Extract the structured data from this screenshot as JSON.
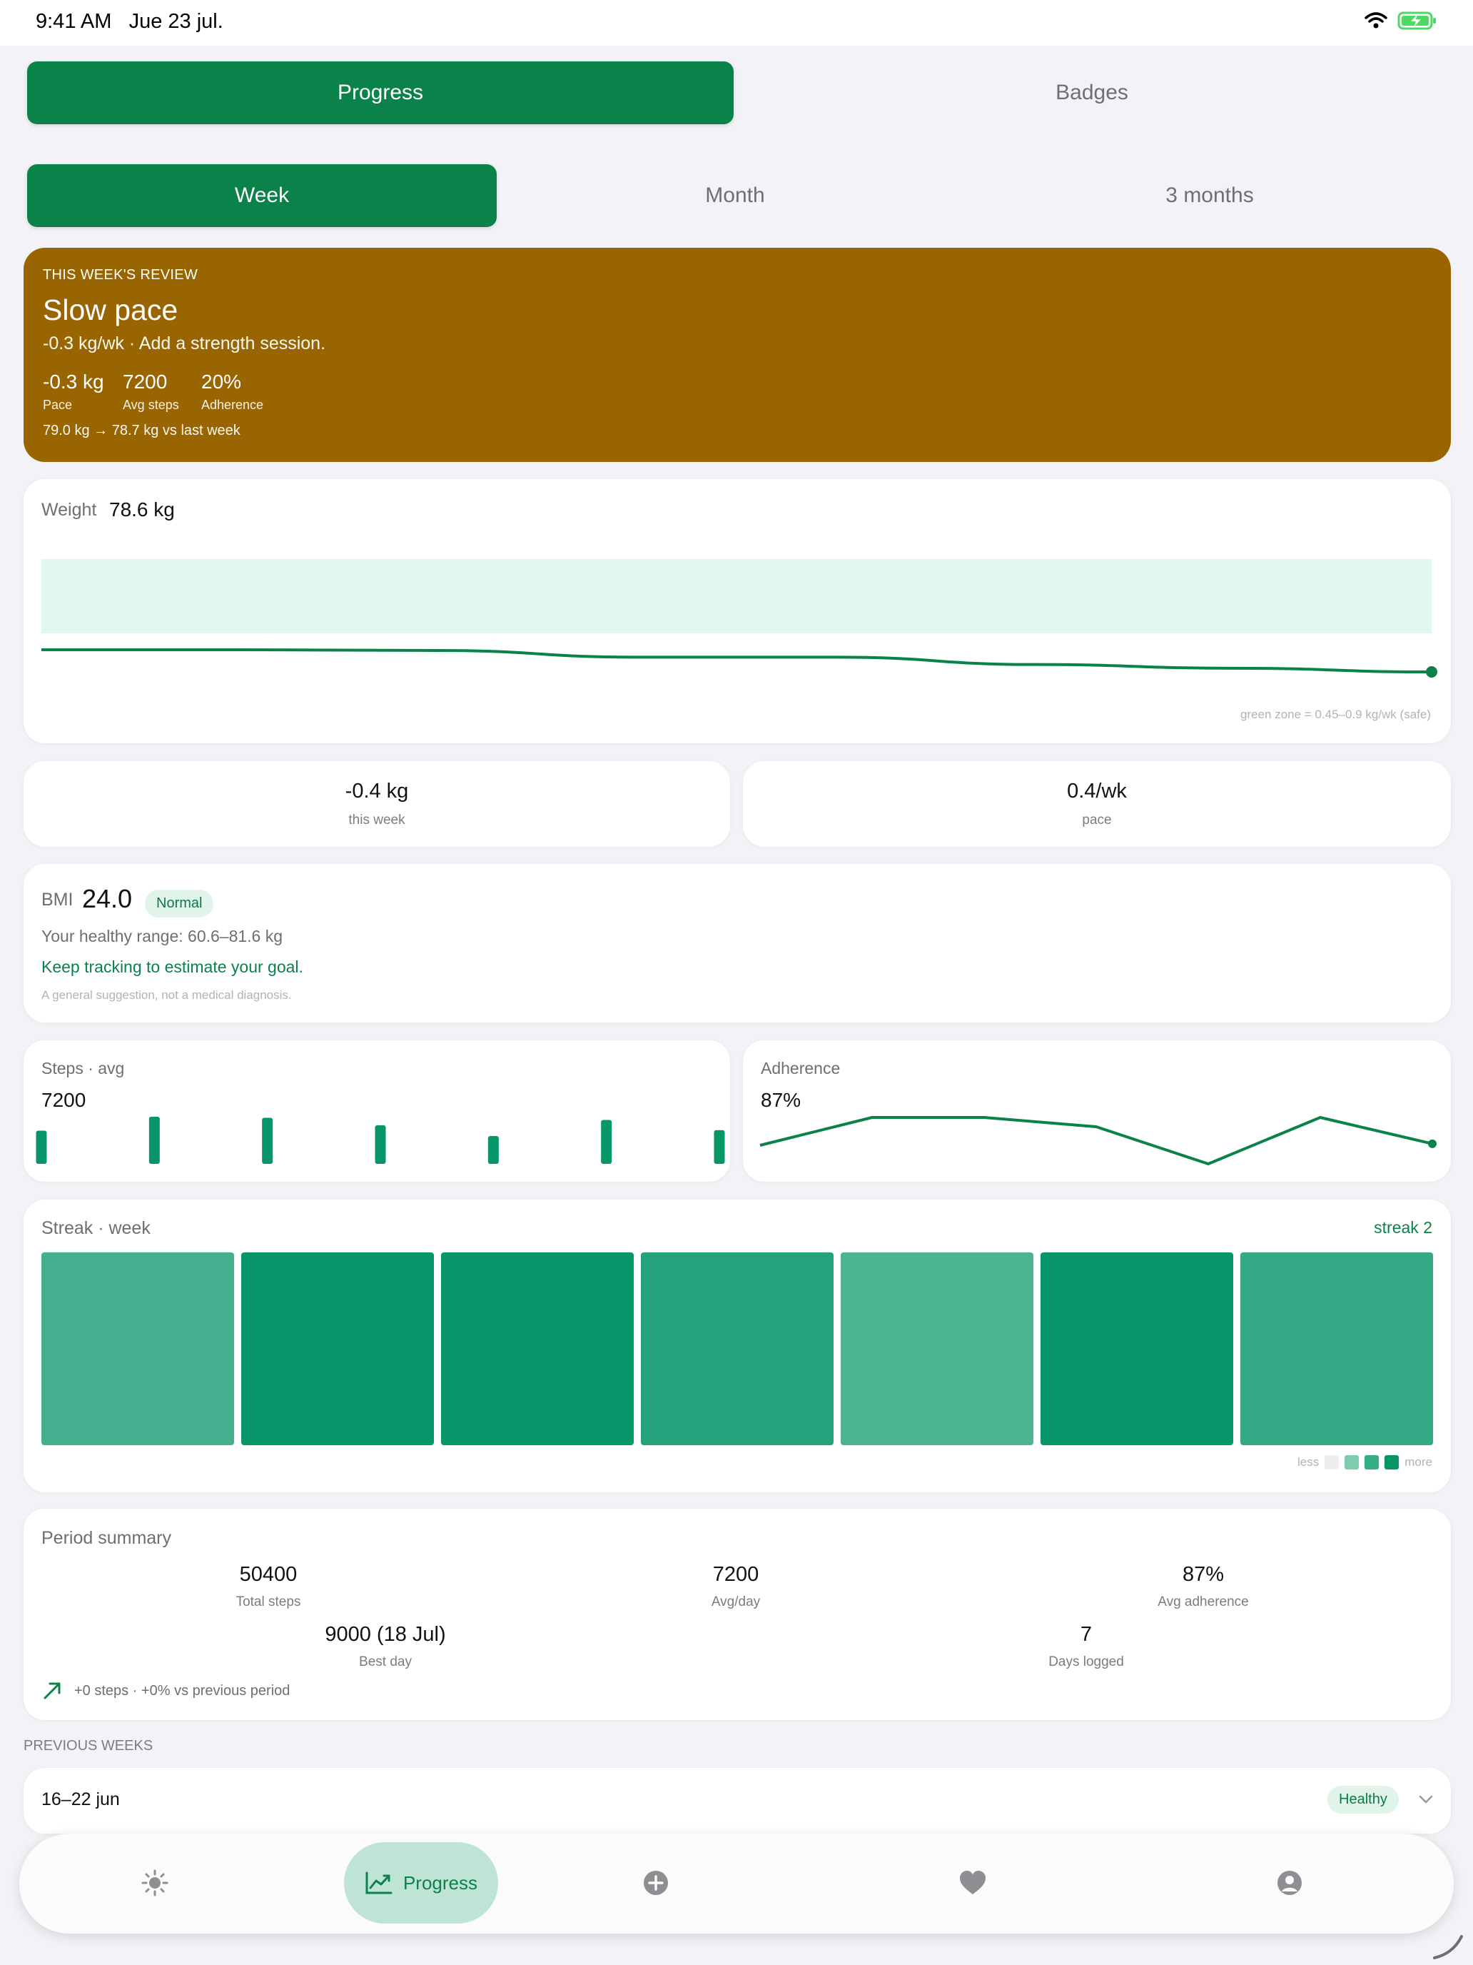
{
  "status_bar": {
    "time": "9:41 AM",
    "date": "Jue 23 jul."
  },
  "top_tabs": [
    {
      "label": "Progress",
      "active": true
    },
    {
      "label": "Badges",
      "active": false
    }
  ],
  "period_tabs": [
    {
      "label": "Week",
      "active": true
    },
    {
      "label": "Month",
      "active": false
    },
    {
      "label": "3 months",
      "active": false
    }
  ],
  "review": {
    "eyebrow": "THIS WEEK'S REVIEW",
    "title": "Slow pace",
    "subtitle": "-0.3 kg/wk · Add a strength session.",
    "stats": [
      {
        "value": "-0.3 kg",
        "label": "Pace"
      },
      {
        "value": "7200",
        "label": "Avg steps"
      },
      {
        "value": "20%",
        "label": "Adherence"
      }
    ],
    "footer": "79.0 kg → 78.7 kg vs last week",
    "color": "#996500"
  },
  "weight_card": {
    "label": "Weight",
    "value": "78.6 kg",
    "note": "green zone = 0.45–0.9 kg/wk (safe)"
  },
  "weight_chart": {
    "type": "line",
    "values": [
      79.0,
      79.0,
      78.99,
      78.9,
      78.9,
      78.8,
      78.75,
      78.7
    ]
  },
  "delta_cards": [
    {
      "value": "-0.4 kg",
      "label": "this week"
    },
    {
      "value": "0.4/wk",
      "label": "pace"
    }
  ],
  "bmi": {
    "label": "BMI",
    "value": "24.0",
    "status": "Normal",
    "range": "Your healthy range: 60.6–81.6 kg",
    "tip": "Keep tracking to estimate your goal.",
    "disclaimer": "A general suggestion, not a medical diagnosis."
  },
  "steps_card": {
    "label": "Steps · avg",
    "value": "7200"
  },
  "steps_chart": {
    "type": "bar",
    "values": [
      6200,
      8800,
      8600,
      7200,
      5200,
      8200,
      6300
    ]
  },
  "adherence_card": {
    "label": "Adherence",
    "value": "87%"
  },
  "adherence_chart": {
    "type": "line",
    "values": [
      82,
      100,
      100,
      94,
      70,
      100,
      83
    ]
  },
  "streak": {
    "label": "Streak · week",
    "streak_text": "streak 2",
    "levels": [
      0.75,
      1.0,
      1.0,
      0.88,
      0.72,
      1.0,
      0.82
    ],
    "legend_less": "less",
    "legend_more": "more"
  },
  "summary": {
    "title": "Period summary",
    "items": [
      {
        "value": "50400",
        "label": "Total steps"
      },
      {
        "value": "7200",
        "label": "Avg/day"
      },
      {
        "value": "87%",
        "label": "Avg adherence"
      },
      {
        "value": "9000 (18 Jul)",
        "label": "Best day"
      },
      {
        "value": "7",
        "label": "Days logged"
      }
    ],
    "trend": "+0 steps · +0% vs previous period"
  },
  "previous_weeks": {
    "heading": "PREVIOUS WEEKS",
    "items": [
      {
        "range": "16–22 jun",
        "status": "Healthy"
      }
    ]
  },
  "nav": {
    "active_label": "Progress",
    "icons": [
      "sun-icon",
      "chart-icon",
      "plus-circle-icon",
      "heart-icon",
      "profile-icon"
    ]
  },
  "colors": {
    "accent": "#0b8249",
    "review_bg": "#996500",
    "green_zone": "#e1f6ec",
    "background": "#f2f2f7"
  }
}
